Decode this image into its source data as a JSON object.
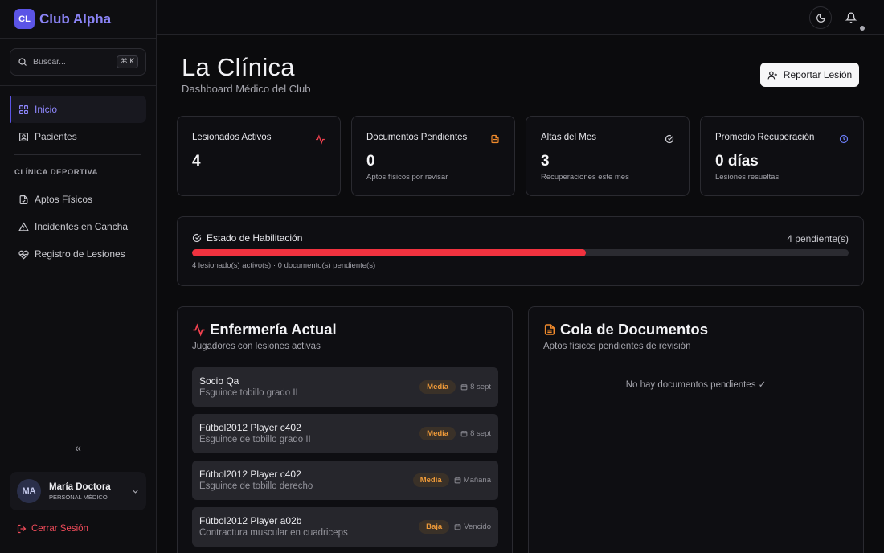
{
  "brand": {
    "logo": "CL",
    "name": "Club Alpha"
  },
  "search": {
    "placeholder": "Buscar...",
    "shortcut": "⌘ K"
  },
  "nav": {
    "items": [
      {
        "label": "Inicio",
        "icon": "grid-icon",
        "active": true
      },
      {
        "label": "Pacientes",
        "icon": "id-card-icon"
      }
    ],
    "section_title": "CLÍNICA DEPORTIVA",
    "section_items": [
      {
        "label": "Aptos Físicos",
        "icon": "file-icon"
      },
      {
        "label": "Incidentes en Cancha",
        "icon": "warning-icon"
      },
      {
        "label": "Registro de Lesiones",
        "icon": "heart-pulse-icon"
      }
    ],
    "collapse_glyph": "«"
  },
  "user": {
    "initials": "MA",
    "name": "María Doctora",
    "role": "PERSONAL MÉDICO"
  },
  "logout_label": "Cerrar Sesión",
  "header": {
    "title": "La Clínica",
    "subtitle": "Dashboard Médico del Club",
    "report_label": "Reportar Lesión"
  },
  "stats": [
    {
      "label": "Lesionados Activos",
      "value": "4",
      "desc": "",
      "icon": "activity-icon",
      "color": "#f0414f"
    },
    {
      "label": "Documentos Pendientes",
      "value": "0",
      "desc": "Aptos físicos por revisar",
      "icon": "document-icon",
      "color": "#f08a2c"
    },
    {
      "label": "Altas del Mes",
      "value": "3",
      "desc": "Recuperaciones este mes",
      "icon": "check-circle-icon",
      "color": "#d0d0d6"
    },
    {
      "label": "Promedio Recuperación",
      "value": "0 días",
      "desc": "Lesiones resueltas",
      "icon": "clock-icon",
      "color": "#6a7cf5"
    }
  ],
  "habilitacion": {
    "title": "Estado de Habilitación",
    "count": "4 pendiente(s)",
    "progress": 0.6,
    "note": "4 lesionado(s) activo(s) · 0 documento(s) pendiente(s)"
  },
  "infirmary": {
    "title": "Enfermería Actual",
    "subtitle": "Jugadores con lesiones activas",
    "items": [
      {
        "name": "Socio Qa",
        "desc": "Esguince tobillo grado II",
        "severity": "Media",
        "date": "8 sept"
      },
      {
        "name": "Fútbol2012 Player c402",
        "desc": "Esguince de tobillo grado II",
        "severity": "Media",
        "date": "8 sept"
      },
      {
        "name": "Fútbol2012 Player c402",
        "desc": "Esguince de tobillo derecho",
        "severity": "Media",
        "date": "Mañana"
      },
      {
        "name": "Fútbol2012 Player a02b",
        "desc": "Contractura muscular en cuadriceps",
        "severity": "Baja",
        "date": "Vencido"
      }
    ]
  },
  "documents": {
    "title": "Cola de Documentos",
    "subtitle": "Aptos físicos pendientes de revisión",
    "empty": "No hay documentos pendientes ✓"
  }
}
